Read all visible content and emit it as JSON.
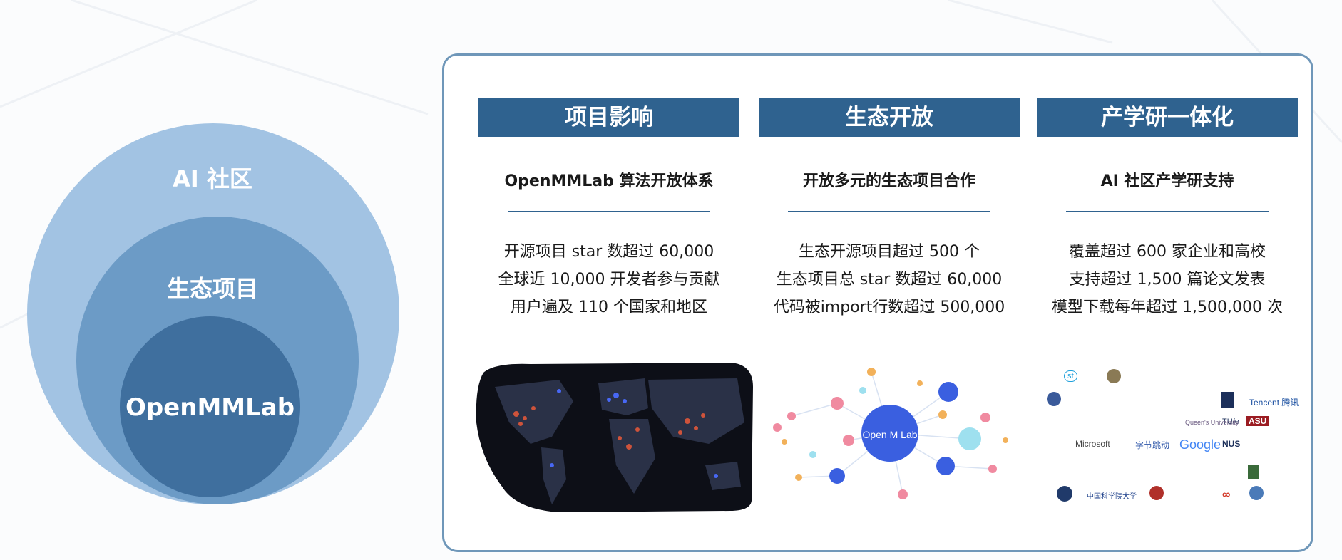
{
  "circles": {
    "outer_label": "AI 社区",
    "middle_label": "生态项目",
    "inner_label": "OpenMMLab"
  },
  "columns": [
    {
      "header": "项目影响",
      "subtitle": "OpenMMLab 算法开放体系",
      "stats": [
        "开源项目 star 数超过 60,000",
        "全球近 10,000 开发者参与贡献",
        "用户遍及 110 个国家和地区"
      ]
    },
    {
      "header": "生态开放",
      "subtitle": "开放多元的生态项目合作",
      "stats": [
        "生态开源项目超过 500 个",
        "生态项目总 star 数超过 60,000",
        "代码被import行数超过 500,000"
      ]
    },
    {
      "header": "产学研一体化",
      "subtitle": "AI 社区产学研支持",
      "stats": [
        "覆盖超过 600 家企业和高校",
        "支持超过 1,500 篇论文发表",
        "模型下载每年超过 1,500,000 次"
      ]
    }
  ],
  "network": {
    "center_label": "Open M Lab"
  },
  "partner_logos": [
    "Microsoft",
    "字节跳动",
    "Google",
    "NUS",
    "Tencent 腾讯",
    "TU/e",
    "ASU",
    "Queen's University",
    "中国科学院大学"
  ],
  "colors": {
    "header_bg": "#2f628f",
    "panel_border": "#6f97b9",
    "circle_outer": "#a2c3e3",
    "circle_middle": "#6c9bc6",
    "circle_inner": "#3f6f9e",
    "network_hub": "#3a5fe0"
  }
}
